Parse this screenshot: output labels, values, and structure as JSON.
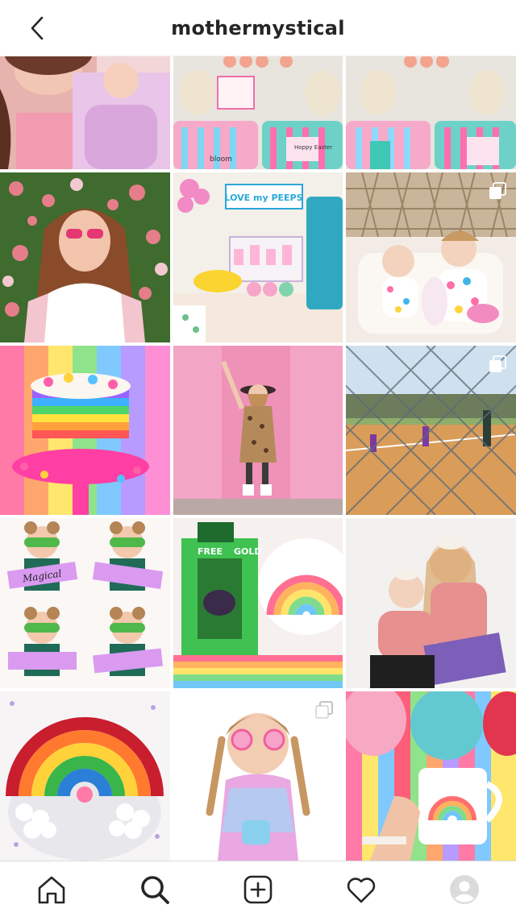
{
  "header": {
    "username": "mothermystical"
  },
  "grid": {
    "tiles": [
      {
        "id": "post-1",
        "icon": null
      },
      {
        "id": "post-2",
        "icon": null
      },
      {
        "id": "post-3",
        "icon": null
      },
      {
        "id": "post-4",
        "icon": null
      },
      {
        "id": "post-5",
        "icon": null
      },
      {
        "id": "post-6",
        "icon": "multi-photo-icon"
      },
      {
        "id": "post-7",
        "icon": null
      },
      {
        "id": "post-8",
        "icon": null
      },
      {
        "id": "post-9",
        "icon": "multi-photo-icon"
      },
      {
        "id": "post-10",
        "icon": null
      },
      {
        "id": "post-11",
        "icon": null
      },
      {
        "id": "post-12",
        "icon": null
      },
      {
        "id": "post-13",
        "icon": null
      },
      {
        "id": "post-14",
        "icon": "multi-photo-icon"
      },
      {
        "id": "post-15",
        "icon": null
      }
    ],
    "photo_text": {
      "love_my_peeps": "LOVE my PEEPS",
      "free": "FREE",
      "gold": "GOLD",
      "magical": "Magical",
      "bloom": "bloom",
      "hoppy_easter": "Hoppy Easter"
    }
  },
  "tabbar": {
    "items": [
      "home-icon",
      "search-icon",
      "new-post-icon",
      "activity-icon",
      "profile-icon"
    ],
    "active": "search-icon"
  },
  "colors": {
    "icon": "#262626",
    "border": "#dbdbdb",
    "background": "#ffffff"
  }
}
